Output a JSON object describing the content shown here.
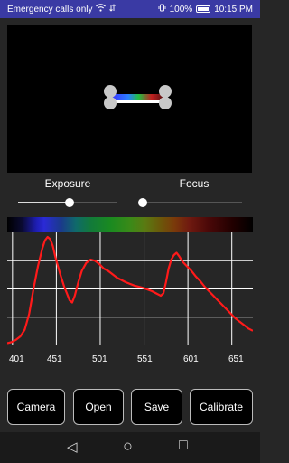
{
  "status_bar": {
    "carrier_text": "Emergency calls only",
    "battery": "100%",
    "time": "10:15 PM",
    "icons": [
      "wifi-icon",
      "vibrate-icon",
      "battery-icon"
    ]
  },
  "controls": {
    "exposure_label": "Exposure",
    "focus_label": "Focus",
    "exposure_value": 0.52,
    "focus_value": 0.0
  },
  "chart_data": {
    "type": "line",
    "title": "",
    "xlabel": "",
    "ylabel": "",
    "xlim": [
      395,
      675
    ],
    "ylim": [
      0,
      100
    ],
    "x_ticks": [
      "401",
      "451",
      "501",
      "551",
      "601",
      "651"
    ],
    "grid": true,
    "series": [
      {
        "color": "#ff1a1a",
        "x": [
          395,
          400,
          405,
          410,
          415,
          420,
          425,
          430,
          435,
          438,
          441,
          444,
          447,
          450,
          455,
          460,
          463,
          466,
          469,
          472,
          476,
          480,
          485,
          490,
          495,
          500,
          505,
          510,
          515,
          520,
          525,
          530,
          540,
          550,
          560,
          565,
          570,
          573,
          576,
          579,
          582,
          585,
          588,
          591,
          595,
          600,
          605,
          610,
          615,
          620,
          625,
          630,
          635,
          640,
          645,
          650,
          655,
          660,
          665,
          670,
          675
        ],
        "y": [
          2,
          3,
          5,
          8,
          14,
          28,
          50,
          70,
          86,
          93,
          96,
          94,
          88,
          78,
          64,
          52,
          46,
          40,
          38,
          44,
          56,
          66,
          73,
          76,
          75,
          72,
          68,
          66,
          63,
          60,
          58,
          56,
          53,
          51,
          48,
          46,
          44,
          46,
          56,
          68,
          76,
          80,
          82,
          79,
          74,
          70,
          66,
          61,
          57,
          52,
          48,
          44,
          40,
          36,
          32,
          28,
          24,
          21,
          18,
          15,
          13
        ]
      }
    ]
  },
  "buttons": {
    "camera": "Camera",
    "open": "Open",
    "save": "Save",
    "calibrate": "Calibrate"
  },
  "nav": {
    "back": "◁",
    "home": "○",
    "recents": "□"
  }
}
